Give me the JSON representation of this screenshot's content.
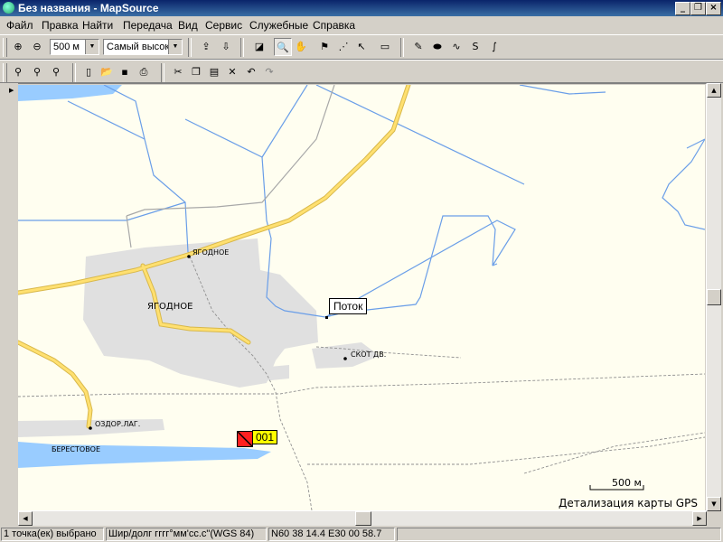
{
  "window": {
    "title": "Без названия - MapSource"
  },
  "menu": [
    "Файл",
    "Правка",
    "Найти",
    "Передача",
    "Вид",
    "Сервис",
    "Служебные",
    "Справка"
  ],
  "toolbar": {
    "zoom_scale": "500 м",
    "detail_level": "Самый высокий"
  },
  "map": {
    "settlement_label": "ЯГОДНОЕ",
    "settlement_area_label": "ЯГОДНОЕ",
    "farm_label": "СКОТ ДВ.",
    "camp_label": "ОЗДОР.ЛАГ.",
    "lake_label": "БЕРЕСТОВОЕ",
    "stream_label": "Поток",
    "waypoint_label": "001",
    "scale_label": "500 м",
    "detail_note": "Детализация карты GPS"
  },
  "status": {
    "selection": "1 точка(ек) выбрано",
    "format": "Шир/долг гггг°мм'сс.с\"(WGS 84)",
    "coords": "N60 38 14.4 E30 00 58.7"
  }
}
